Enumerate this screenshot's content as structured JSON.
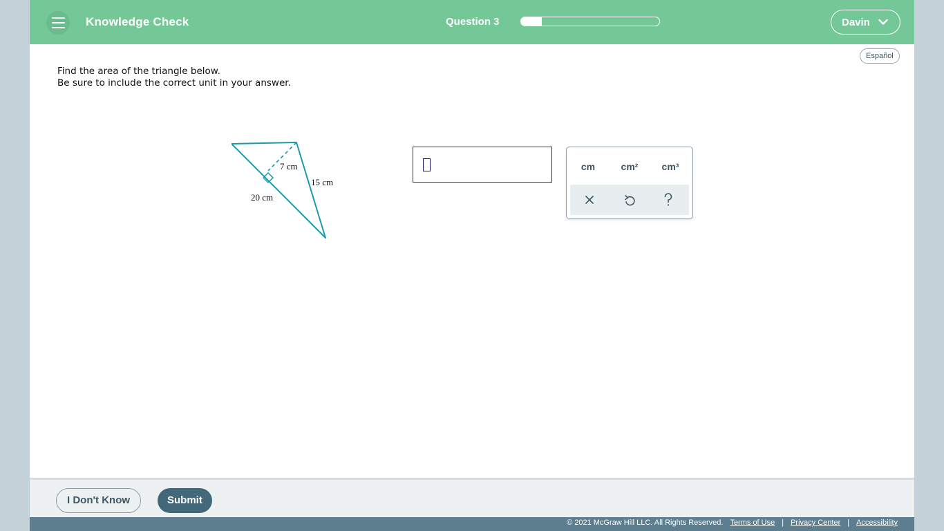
{
  "header": {
    "title": "Knowledge Check",
    "question_label": "Question 3",
    "progress_fraction": 0.15,
    "user_name": "Davin",
    "accent_color": "#74c797"
  },
  "language_toggle": "Español",
  "instructions": {
    "line1": "Find the area of the triangle below.",
    "line2": "Be sure to include the correct unit in your answer."
  },
  "figure": {
    "height_label": "7 cm",
    "side_label": "15 cm",
    "base_label": "20 cm"
  },
  "answer": {
    "value": ""
  },
  "palette": {
    "units": [
      "cm",
      "cm²",
      "cm³"
    ],
    "actions": [
      "clear-icon",
      "undo-icon",
      "help-icon"
    ]
  },
  "footer": {
    "dont_know_label": "I Don't Know",
    "submit_label": "Submit"
  },
  "legal": {
    "copyright": "© 2021 McGraw Hill LLC. All Rights Reserved.",
    "terms": "Terms of Use",
    "privacy": "Privacy Center",
    "accessibility": "Accessibility",
    "separator": "|"
  }
}
